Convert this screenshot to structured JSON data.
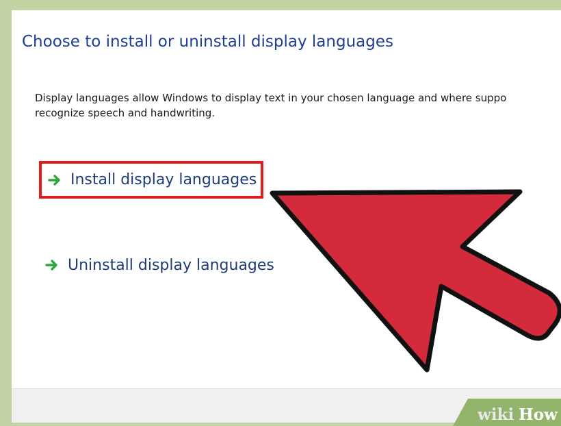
{
  "panel": {
    "title": "Choose to install or uninstall display languages",
    "description_line1": "Display languages allow Windows to display text in your chosen language and where suppo",
    "description_line2": "recognize speech and handwriting."
  },
  "options": [
    {
      "label": "Install display languages",
      "icon": "green-arrow-icon",
      "highlighted": true
    },
    {
      "label": "Uninstall display languages",
      "icon": "green-arrow-icon",
      "highlighted": false
    }
  ],
  "annotation": {
    "pointer_icon": "red-pointer-arrow",
    "highlight_color": "#e01c1c"
  },
  "watermark": {
    "text_wiki": "wiki",
    "text_how": "How"
  },
  "colors": {
    "title": "#1e3e93",
    "link": "#1f3c78",
    "arrow_fill": "#d32b3b",
    "icon_green": "#2fa83a",
    "frame": "#c3d3a4"
  }
}
